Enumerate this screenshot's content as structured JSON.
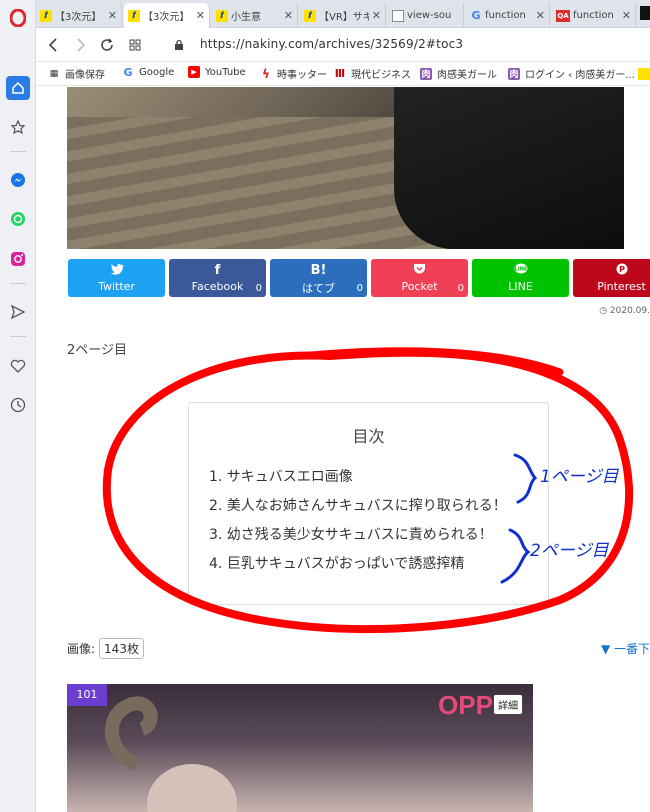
{
  "sidebar": {
    "items": [
      {
        "icon": "opera-logo-icon"
      },
      {
        "icon": "home-icon"
      },
      {
        "icon": "speed-dial-icon"
      },
      {
        "icon": "messenger-icon"
      },
      {
        "icon": "whatsapp-icon"
      },
      {
        "icon": "instagram-icon"
      },
      {
        "icon": "send-icon"
      },
      {
        "icon": "heart-icon"
      },
      {
        "icon": "history-icon"
      }
    ]
  },
  "tabs": [
    {
      "label": "【3次元】",
      "favicon": "nakiny-favicon",
      "active": false
    },
    {
      "label": "【3次元】",
      "favicon": "nakiny-favicon",
      "active": true
    },
    {
      "label": "小生意",
      "favicon": "nakiny-favicon",
      "active": false
    },
    {
      "label": "【VR】サキ",
      "favicon": "nakiny-favicon",
      "active": false
    },
    {
      "label": "view-sou",
      "favicon": "page-favicon",
      "active": false
    },
    {
      "label": "function",
      "favicon": "google-favicon",
      "active": false
    },
    {
      "label": "function",
      "favicon": "qa-favicon",
      "active": false
    }
  ],
  "address": {
    "url": "https://nakiny.com/archives/32569/2#toc3"
  },
  "bookmarks": [
    {
      "label": "画像保存",
      "icon": "bookmark-icon"
    },
    {
      "label": "Google",
      "icon": "google-icon"
    },
    {
      "label": "YouTube",
      "icon": "youtube-icon"
    },
    {
      "label": "時事ッター",
      "icon": "bolt-icon"
    },
    {
      "label": "現代ビジネス",
      "icon": "gendai-icon"
    },
    {
      "label": "肉感美ガール",
      "icon": "niku-icon"
    },
    {
      "label": "ログイン ‹ 肉感美ガー...",
      "icon": "niku-icon"
    }
  ],
  "share": [
    {
      "label": "Twitter",
      "icon": "twitter-icon",
      "glyph": "🐦",
      "count": "",
      "color": "#1da1f2"
    },
    {
      "label": "Facebook",
      "icon": "facebook-icon",
      "glyph": "f",
      "count": "0",
      "color": "#3b5998"
    },
    {
      "label": "はてブ",
      "icon": "hatena-icon",
      "glyph": "B!",
      "count": "0",
      "color": "#2c6ebd"
    },
    {
      "label": "Pocket",
      "icon": "pocket-icon",
      "glyph": "♡",
      "count": "0",
      "color": "#ef4056"
    },
    {
      "label": "LINE",
      "icon": "line-icon",
      "glyph": "…",
      "count": "",
      "color": "#00c300"
    },
    {
      "label": "Pinterest",
      "icon": "pinterest-icon",
      "glyph": "P",
      "count": "",
      "color": "#bd081c"
    }
  ],
  "date": "2020.09.",
  "page_label": "2ページ目",
  "toc": {
    "title": "目次",
    "items": [
      "1. サキュバスエロ画像",
      "2. 美人なお姉さんサキュバスに搾り取られる！",
      "3. 幼さ残る美少女サキュバスに責められる！",
      "4. 巨乳サキュバスがおっぱいで誘惑搾精"
    ]
  },
  "image_count": {
    "label": "画像:",
    "value": "143枚"
  },
  "to_top": "▼ 一番下",
  "photo": {
    "number": "101",
    "detail": "詳細",
    "brand": "OPP"
  },
  "annotations": {
    "note1": "1ページ目",
    "note2": "2ページ目",
    "ring_color": "#ff0000",
    "ink_color": "#1030d0"
  }
}
